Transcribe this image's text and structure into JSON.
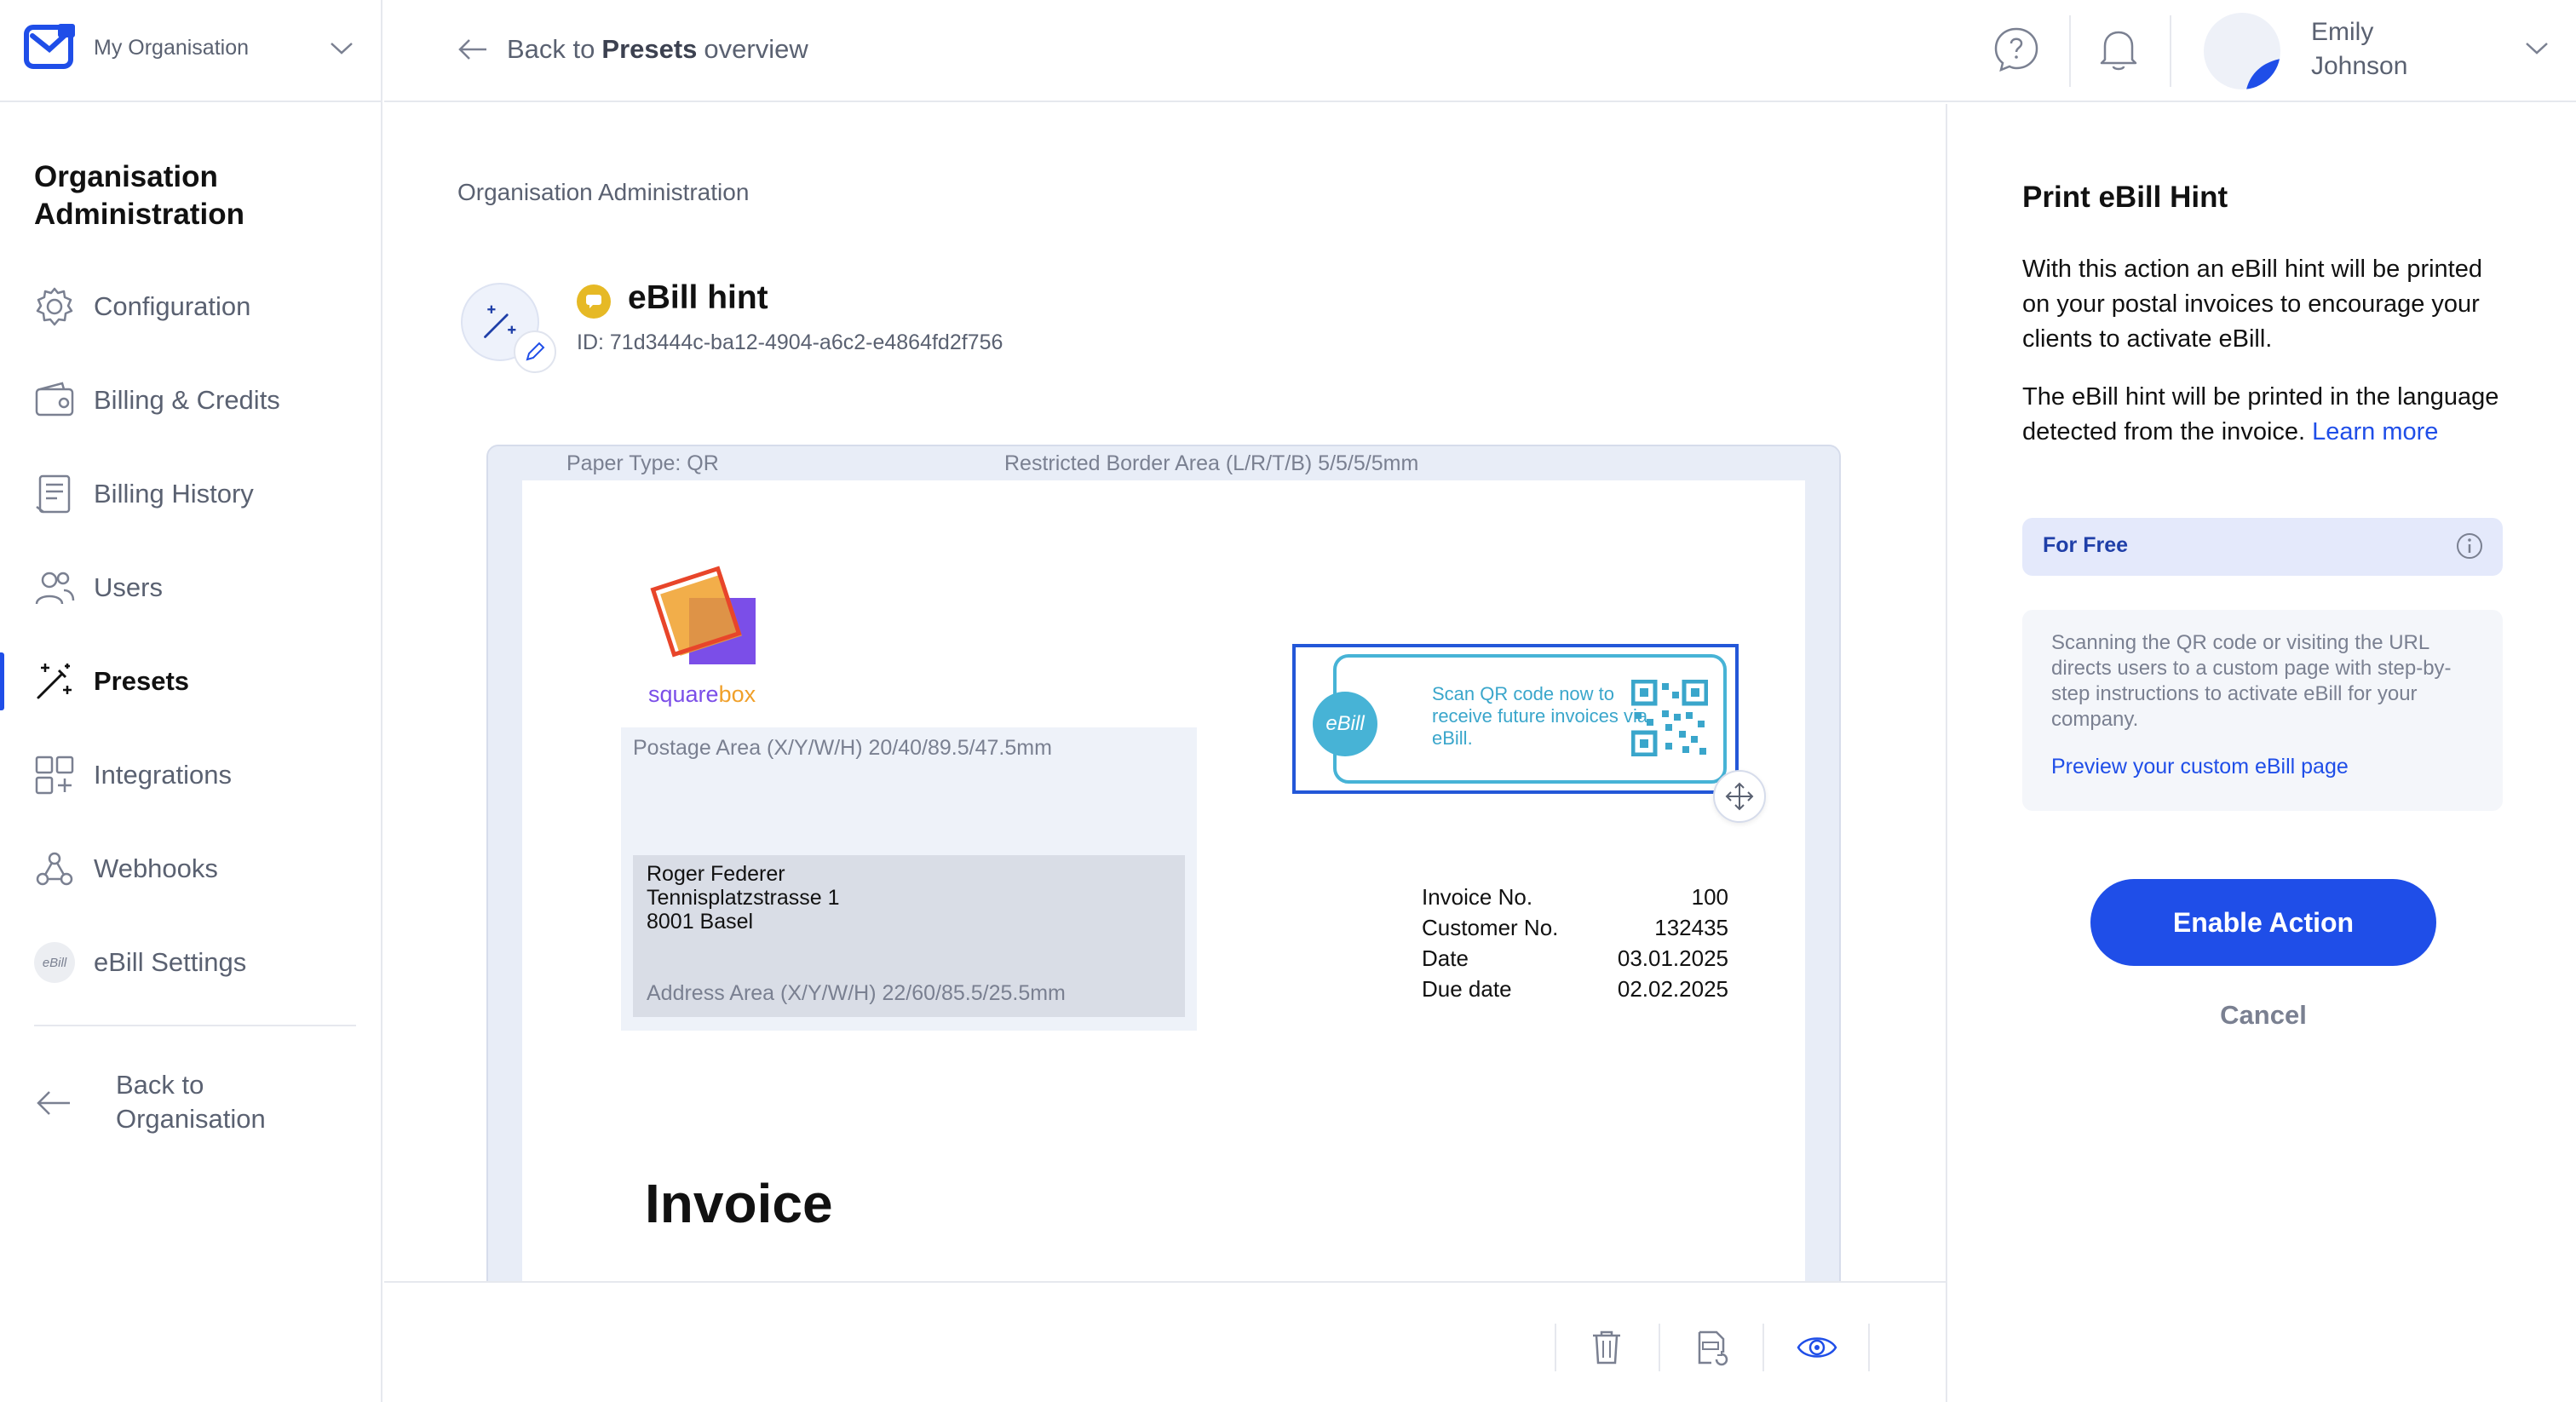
{
  "org": {
    "name": "My Organisation"
  },
  "sidebar": {
    "section_title": "Organisation Administration",
    "items": [
      {
        "label": "Configuration"
      },
      {
        "label": "Billing & Credits"
      },
      {
        "label": "Billing History"
      },
      {
        "label": "Users"
      },
      {
        "label": "Presets"
      },
      {
        "label": "Integrations"
      },
      {
        "label": "Webhooks"
      },
      {
        "label": "eBill Settings"
      }
    ],
    "active_item": "Presets",
    "back_label": "Back to Organisation",
    "ebill_icon_text": "eBill"
  },
  "topbar": {
    "back_prefix": "Back to",
    "back_bold": "Presets",
    "back_suffix": "overview",
    "user_first": "Emily",
    "user_last": "Johnson"
  },
  "main": {
    "breadcrumb": "Organisation Administration",
    "preset_name": "eBill hint",
    "preset_id": "ID: 71d3444c-ba12-4904-a6c2-e4864fd2f756"
  },
  "document": {
    "paper_type": "Paper Type: QR",
    "border_area": "Restricted Border Area (L/R/T/B) 5/5/5/5mm",
    "logo_part1": "square",
    "logo_part2": "box",
    "postage_area": "Postage Area (X/Y/W/H) 20/40/89.5/47.5mm",
    "address_lines": [
      "Roger Federer",
      "Tennisplatzstrasse 1",
      "8001 Basel"
    ],
    "address_area": "Address Area (X/Y/W/H) 22/60/85.5/25.5mm",
    "ebill_badge": "eBill",
    "ebill_hint_text": "Scan QR code now to receive future invoices via eBill.",
    "invoice_meta": [
      {
        "key": "Invoice No.",
        "value": "100"
      },
      {
        "key": "Customer No.",
        "value": "132435"
      },
      {
        "key": "Date",
        "value": "03.01.2025"
      },
      {
        "key": "Due date",
        "value": "02.02.2025"
      }
    ],
    "invoice_title": "Invoice"
  },
  "panel": {
    "title": "Print eBill Hint",
    "para1": "With this action an eBill hint will be printed on your postal invoices to encourage your clients to activate eBill.",
    "para2": "The eBill hint will be printed in the language detected from the invoice.",
    "learn_more": "Learn more",
    "free_label": "For Free",
    "info_text": "Scanning the QR code or visiting the URL directs users to a custom page with step-by-step instructions to activate eBill for your company.",
    "info_link": "Preview your custom eBill page",
    "enable_label": "Enable Action",
    "cancel_label": "Cancel"
  },
  "colors": {
    "accent": "#1f4ee8",
    "ebill_blue": "#47b3d6",
    "badge_yellow": "#e6b925"
  }
}
